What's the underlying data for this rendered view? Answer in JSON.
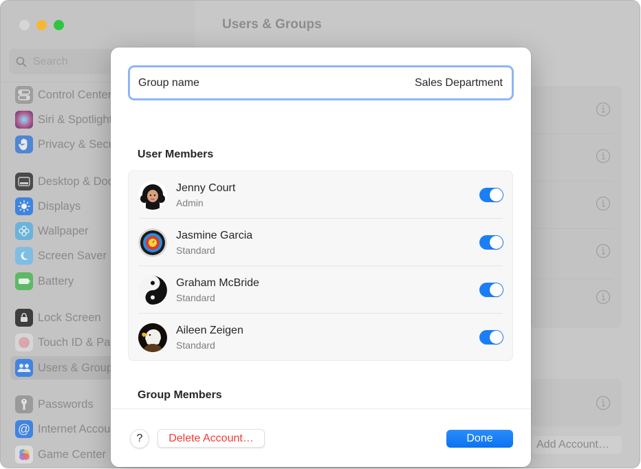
{
  "window": {
    "traffic_lights": [
      "close",
      "minimize",
      "maximize"
    ],
    "title": "Users & Groups"
  },
  "sidebar": {
    "search_placeholder": "Search",
    "items": [
      {
        "label": "Control Center",
        "icon": "control-center-icon",
        "color": "#9e9e9e"
      },
      {
        "label": "Siri & Spotlight",
        "icon": "siri-icon",
        "color": "#7a5a8a"
      },
      {
        "label": "Privacy & Security",
        "icon": "hand-icon",
        "color": "#4f86d6"
      },
      {
        "label": "Desktop & Dock",
        "icon": "desktop-icon",
        "color": "#4a4a4a"
      },
      {
        "label": "Displays",
        "icon": "sun-icon",
        "color": "#3f84e0"
      },
      {
        "label": "Wallpaper",
        "icon": "flower-icon",
        "color": "#6bb3d9"
      },
      {
        "label": "Screen Saver",
        "icon": "moon-icon",
        "color": "#7fbde3"
      },
      {
        "label": "Battery",
        "icon": "battery-icon",
        "color": "#5fb865"
      },
      {
        "label": "Lock Screen",
        "icon": "lock-icon",
        "color": "#3e3e3e"
      },
      {
        "label": "Touch ID & Password",
        "icon": "fingerprint-icon",
        "color": "#e0e0e0"
      },
      {
        "label": "Users & Groups",
        "icon": "users-icon",
        "color": "#3f84e0",
        "active": true
      },
      {
        "label": "Passwords",
        "icon": "key-icon",
        "color": "#9a9a9a"
      },
      {
        "label": "Internet Accounts",
        "icon": "at-icon",
        "color": "#3f84e0"
      },
      {
        "label": "Game Center",
        "icon": "game-center-icon",
        "color": "#e0e0e0"
      }
    ]
  },
  "background_main": {
    "add_account_label": "Add Account…"
  },
  "sheet": {
    "group_name_label": "Group name",
    "group_name_value": "Sales Department",
    "user_members_title": "User Members",
    "group_members_title": "Group Members",
    "members": [
      {
        "name": "Jenny Court",
        "role": "Admin",
        "avatar": "memoji-avatar",
        "enabled": true
      },
      {
        "name": "Jasmine Garcia",
        "role": "Standard",
        "avatar": "target-avatar",
        "enabled": true
      },
      {
        "name": "Graham McBride",
        "role": "Standard",
        "avatar": "yin-yang-avatar",
        "enabled": true
      },
      {
        "name": "Aileen Zeigen",
        "role": "Standard",
        "avatar": "eagle-avatar",
        "enabled": true
      }
    ],
    "help_label": "?",
    "delete_label": "Delete Account…",
    "done_label": "Done",
    "accent_color": "#1a7ff5",
    "destructive_color": "#f03a35"
  }
}
